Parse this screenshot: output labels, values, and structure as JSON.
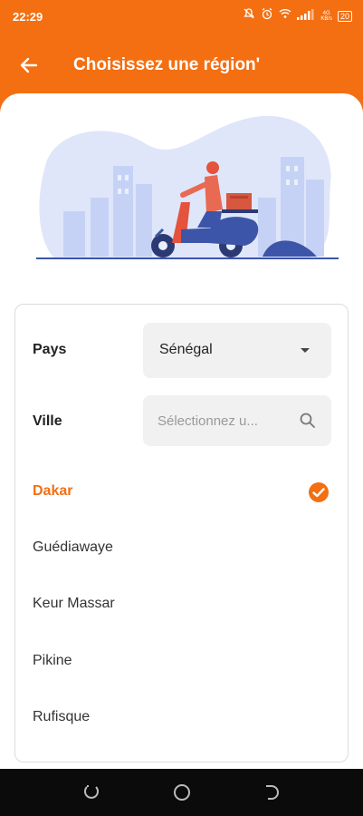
{
  "status_bar": {
    "time": "22:29",
    "network_label": "4G",
    "network_label_2": "KB/s",
    "battery": "20"
  },
  "app_bar": {
    "title": "Choisissez une région'",
    "back_icon": "arrow-left-icon"
  },
  "form": {
    "country_label": "Pays",
    "country_value": "Sénégal",
    "city_label": "Ville",
    "city_placeholder": "Sélectionnez u..."
  },
  "regions": [
    {
      "label": "Dakar",
      "selected": true
    },
    {
      "label": "Guédiawaye",
      "selected": false
    },
    {
      "label": "Keur Massar",
      "selected": false
    },
    {
      "label": "Pikine",
      "selected": false
    },
    {
      "label": "Rufisque",
      "selected": false
    }
  ],
  "colors": {
    "accent": "#f36f12",
    "nav_bar": "#0b0b0b"
  },
  "icons": [
    "arrow-left-icon",
    "caret-down-icon",
    "search-icon",
    "check-circle-icon",
    "recent-apps-icon",
    "home-icon",
    "back-nav-icon"
  ]
}
